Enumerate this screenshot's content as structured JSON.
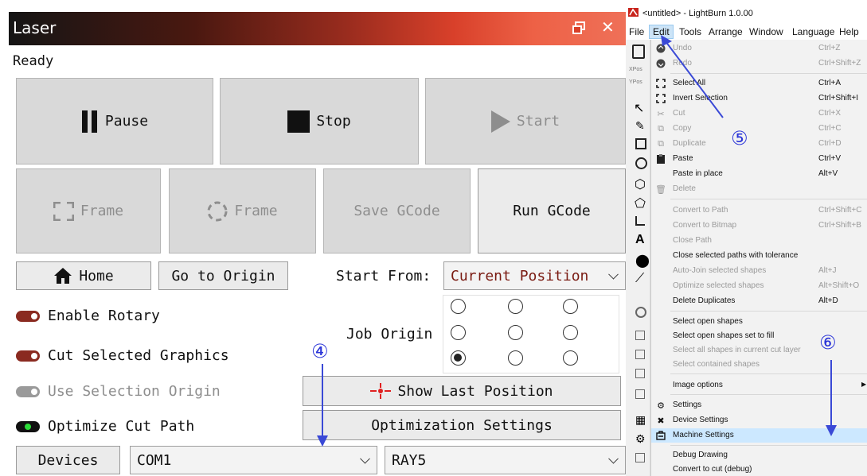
{
  "laser": {
    "title": "Laser",
    "status": "Ready",
    "buttons": {
      "pause": "Pause",
      "stop": "Stop",
      "start": "Start",
      "frame_rect": "Frame",
      "frame_circle": "Frame",
      "save_gcode": "Save GCode",
      "run_gcode": "Run GCode",
      "home": "Home",
      "go_to_origin": "Go to Origin",
      "show_last_position": "Show Last Position",
      "optimization_settings": "Optimization Settings",
      "devices": "Devices"
    },
    "start_from": {
      "label": "Start From:",
      "value": "Current Position"
    },
    "job_origin": {
      "label": "Job Origin",
      "selected_row": 3,
      "selected_col": 1
    },
    "options": [
      {
        "label": "Enable Rotary",
        "state": "off"
      },
      {
        "label": "Cut Selected Graphics",
        "state": "off"
      },
      {
        "label": "Use Selection Origin",
        "state": "disabled"
      },
      {
        "label": "Optimize Cut Path",
        "state": "on"
      }
    ],
    "port_select": "COM1",
    "device_select": "RAY5"
  },
  "annotations": {
    "a4": "④",
    "a5": "⑤",
    "a6": "⑥"
  },
  "lightburn": {
    "window_title": "<untitled> - LightBurn 1.0.00",
    "menubar": [
      "File",
      "Edit",
      "Tools",
      "Arrange",
      "Window",
      "Language",
      "Help"
    ],
    "sidebar_labels": [
      "XPos",
      "YPos"
    ],
    "edit_menu": [
      {
        "label": "Undo",
        "shortcut": "Ctrl+Z",
        "enabled": false,
        "icon": "undo-icon"
      },
      {
        "label": "Redo",
        "shortcut": "Ctrl+Shift+Z",
        "enabled": false,
        "icon": "redo-icon"
      },
      {
        "label": "Select All",
        "shortcut": "Ctrl+A",
        "enabled": true,
        "icon": "select-all-icon"
      },
      {
        "label": "Invert Selection",
        "shortcut": "Ctrl+Shift+I",
        "enabled": true,
        "icon": "invert-selection-icon"
      },
      {
        "label": "Cut",
        "shortcut": "Ctrl+X",
        "enabled": false,
        "icon": "scissors-icon"
      },
      {
        "label": "Copy",
        "shortcut": "Ctrl+C",
        "enabled": false,
        "icon": "copy-icon"
      },
      {
        "label": "Duplicate",
        "shortcut": "Ctrl+D",
        "enabled": false,
        "icon": "duplicate-icon"
      },
      {
        "label": "Paste",
        "shortcut": "Ctrl+V",
        "enabled": true,
        "icon": "paste-icon"
      },
      {
        "label": "Paste in place",
        "shortcut": "Alt+V",
        "enabled": true,
        "icon": ""
      },
      {
        "label": "Delete",
        "shortcut": "",
        "enabled": false,
        "icon": "trash-icon"
      },
      {
        "label": "Convert to Path",
        "shortcut": "Ctrl+Shift+C",
        "enabled": false,
        "icon": ""
      },
      {
        "label": "Convert to Bitmap",
        "shortcut": "Ctrl+Shift+B",
        "enabled": false,
        "icon": ""
      },
      {
        "label": "Close Path",
        "shortcut": "",
        "enabled": false,
        "icon": ""
      },
      {
        "label": "Close selected paths with tolerance",
        "shortcut": "",
        "enabled": true,
        "icon": ""
      },
      {
        "label": "Auto-Join selected shapes",
        "shortcut": "Alt+J",
        "enabled": false,
        "icon": ""
      },
      {
        "label": "Optimize selected shapes",
        "shortcut": "Alt+Shift+O",
        "enabled": false,
        "icon": ""
      },
      {
        "label": "Delete Duplicates",
        "shortcut": "Alt+D",
        "enabled": true,
        "icon": ""
      },
      {
        "label": "Select open shapes",
        "shortcut": "",
        "enabled": true,
        "icon": ""
      },
      {
        "label": "Select open shapes set to fill",
        "shortcut": "",
        "enabled": true,
        "icon": ""
      },
      {
        "label": "Select all shapes in current cut layer",
        "shortcut": "",
        "enabled": false,
        "icon": ""
      },
      {
        "label": "Select contained shapes",
        "shortcut": "",
        "enabled": false,
        "icon": ""
      },
      {
        "label": "Image options",
        "shortcut": "",
        "enabled": true,
        "icon": ""
      },
      {
        "label": "Settings",
        "shortcut": "",
        "enabled": true,
        "icon": "gear-icon"
      },
      {
        "label": "Device Settings",
        "shortcut": "",
        "enabled": true,
        "icon": "tools-icon"
      },
      {
        "label": "Machine Settings",
        "shortcut": "",
        "enabled": true,
        "icon": "machine-icon",
        "highlighted": true
      },
      {
        "label": "Debug Drawing",
        "shortcut": "",
        "enabled": true,
        "icon": ""
      },
      {
        "label": "Convert to cut (debug)",
        "shortcut": "",
        "enabled": true,
        "icon": ""
      }
    ]
  },
  "colors": {
    "accent_red": "#8a2a20",
    "annotation_blue": "#2b35d8",
    "menu_highlight": "#cce8ff"
  }
}
